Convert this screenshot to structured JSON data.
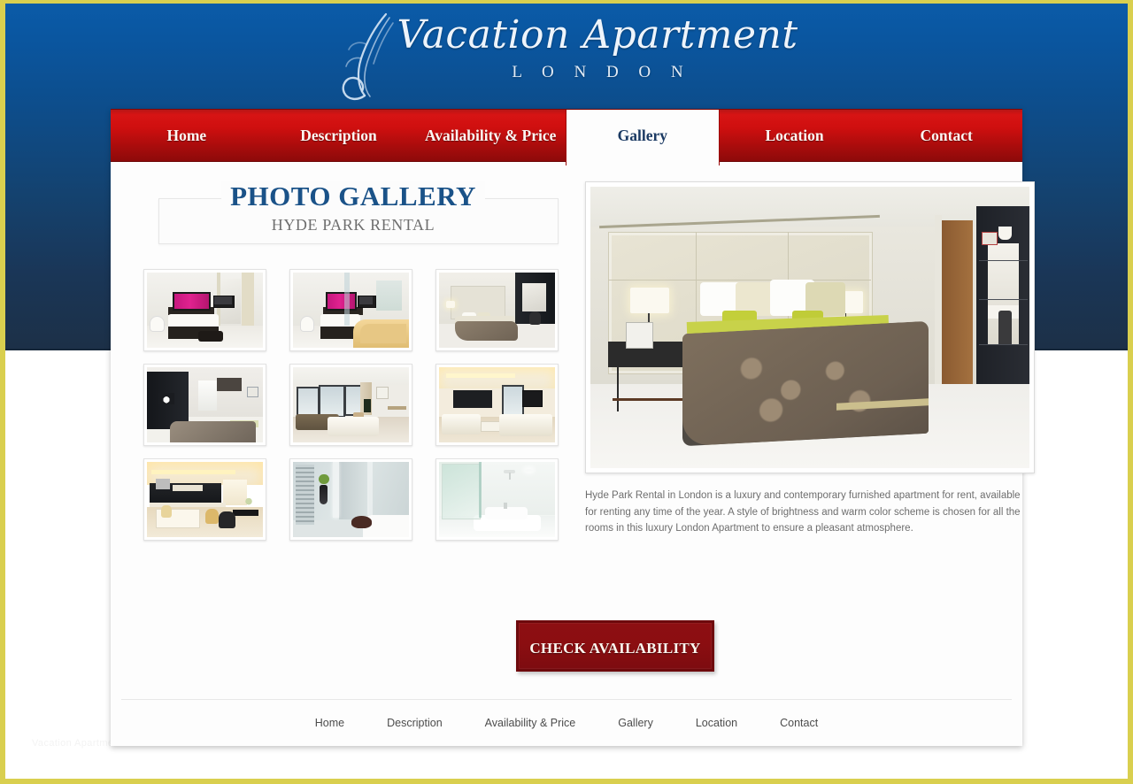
{
  "site": {
    "logo_title": "Vacation Apartment",
    "logo_subtitle": "L O N D O N",
    "logo_flourish_icon": "feather-flourish-icon",
    "accent_blue": "#0b5ba8",
    "accent_navy": "#1c3047",
    "accent_red": "#cf0f0f",
    "accent_dark_red": "#8b0e11",
    "frame_yellow": "#d9cf4f",
    "heading_blue": "#1a5288"
  },
  "nav": {
    "items": [
      {
        "label": "Home",
        "active": false
      },
      {
        "label": "Description",
        "active": false
      },
      {
        "label": "Availability & Price",
        "active": false
      },
      {
        "label": "Gallery",
        "active": true
      },
      {
        "label": "Location",
        "active": false
      },
      {
        "label": "Contact",
        "active": false
      }
    ]
  },
  "gallery": {
    "title": "PHOTO GALLERY",
    "subtitle": "HYDE PARK RENTAL",
    "thumbnails": [
      {
        "alt": "Bedroom with wall-mounted TV and mirrored wall"
      },
      {
        "alt": "Bedroom with open bathtub and glass partition"
      },
      {
        "alt": "Bedroom with dark feature wall and mirror"
      },
      {
        "alt": "Bedroom with dark cabinetry and window"
      },
      {
        "alt": "Living room with corner sofa and city windows"
      },
      {
        "alt": "Bright living room with white sofas and TV"
      },
      {
        "alt": "Open-plan kitchen and dining area"
      },
      {
        "alt": "Bathroom with heated towel rail and shower"
      },
      {
        "alt": "White bathroom with glass shower screen"
      }
    ],
    "main_photo": {
      "alt": "Master bedroom with padded headboard, twin lamps and leopard-print duvet"
    }
  },
  "description": {
    "text": "Hyde Park Rental in London is a luxury and contemporary furnished apartment for rent, available for renting any time of the year. A style of brightness and warm color scheme is chosen for all the rooms in this luxury London Apartment to ensure a pleasant atmosphere."
  },
  "cta": {
    "label": "CHECK AVAILABILITY"
  },
  "footer": {
    "links": [
      {
        "label": "Home"
      },
      {
        "label": "Description"
      },
      {
        "label": "Availability & Price"
      },
      {
        "label": "Gallery"
      },
      {
        "label": "Location"
      },
      {
        "label": "Contact"
      }
    ],
    "watermark": "Vacation Apartment London"
  }
}
